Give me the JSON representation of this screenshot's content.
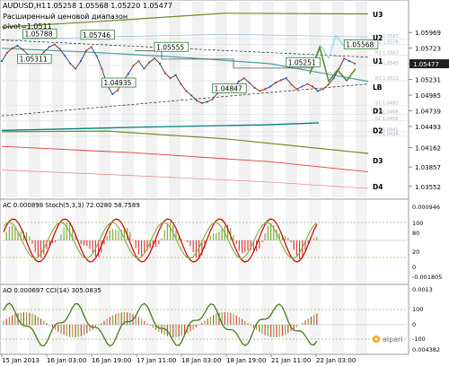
{
  "chart_data": {
    "type": "line",
    "header": {
      "symbol": "AUDUSD,H1",
      "ohlc": "1.05258 1.05568 1.05220 1.05477",
      "subtitle_line1": "Расширенный ценовой диапазон",
      "subtitle_line2": "pivot=1.0511"
    },
    "price_axis": {
      "ylim": [
        1.0338,
        1.0645
      ],
      "ticks": [
        1.05969,
        1.05723,
        1.05477,
        1.05231,
        1.04985,
        1.04739,
        1.04493,
        1.04162,
        1.03857,
        1.03552
      ],
      "current_price": 1.05477
    },
    "level_labels": [
      {
        "label": "U3",
        "value": 1.0625
      },
      {
        "label": "U2",
        "value": 1.0589
      },
      {
        "label": "U1",
        "value": 1.0552
      },
      {
        "label": "LB",
        "value": 1.0511
      },
      {
        "label": "D1",
        "value": 1.0474
      },
      {
        "label": "D2",
        "value": 1.0443
      },
      {
        "label": "D3",
        "value": 1.0396
      },
      {
        "label": "D4",
        "value": 1.0355
      }
    ],
    "fib_labels": [
      {
        "label": "R1 1.0587",
        "value": 1.0587
      },
      {
        "label": "R1 1.0578",
        "value": 1.0578
      },
      {
        "label": "R3 1.0561",
        "value": 1.0561
      },
      {
        "label": "R1 1.0545",
        "value": 1.0545
      },
      {
        "label": "R1 1.0521",
        "value": 1.0521
      },
      {
        "label": "S1 1.0482",
        "value": 1.0482
      },
      {
        "label": "S1 1.0468",
        "value": 1.0468
      },
      {
        "label": "S1 1.0458",
        "value": 1.0458
      },
      {
        "label": "S1 1.0441",
        "value": 1.0441
      },
      {
        "label": "S1 1.0434",
        "value": 1.0434
      }
    ],
    "annotations": [
      {
        "text": "1.05788",
        "x": 4,
        "y": 1.0591
      },
      {
        "text": "1.05746",
        "x": 15,
        "y": 1.0589
      },
      {
        "text": "1.05555",
        "x": 29,
        "y": 1.057
      },
      {
        "text": "1.05311",
        "x": 3,
        "y": 1.0551
      },
      {
        "text": "1.04935",
        "x": 19,
        "y": 1.0514
      },
      {
        "text": "1.05251",
        "x": 54,
        "y": 1.0546
      },
      {
        "text": "1.04847",
        "x": 40,
        "y": 1.0505
      },
      {
        "text": "1.05568",
        "x": 65,
        "y": 1.0574
      }
    ],
    "x_axis_labels": [
      "15 Jan 2013",
      "16 Jan 03:00",
      "16 Jan 19:00",
      "17 Jan 11:00",
      "18 Jan 03:00",
      "18 Jan 19:00",
      "21 Jan 11:00",
      "22 Jan 03:00"
    ],
    "price_series": {
      "x": [
        0,
        1,
        2,
        3,
        4,
        5,
        6,
        7,
        8,
        9,
        10,
        11,
        12,
        13,
        14,
        15,
        16,
        17,
        18,
        19,
        20,
        21,
        22,
        23,
        24,
        25,
        26,
        27,
        28,
        29,
        30,
        31,
        32,
        33,
        34,
        35,
        36,
        37,
        38,
        39,
        40,
        41,
        42,
        43,
        44,
        45,
        46,
        47,
        48,
        49,
        50,
        51,
        52,
        53,
        54,
        55,
        56,
        57,
        58,
        59,
        60,
        61,
        62,
        63,
        64,
        65,
        66,
        67
      ],
      "close": [
        1.0552,
        1.0565,
        1.0572,
        1.0576,
        1.057,
        1.0562,
        1.0555,
        1.0558,
        1.0566,
        1.0574,
        1.0578,
        1.0571,
        1.056,
        1.0548,
        1.054,
        1.0552,
        1.0568,
        1.0574,
        1.056,
        1.054,
        1.0515,
        1.05,
        1.0506,
        1.052,
        1.0532,
        1.0545,
        1.0552,
        1.054,
        1.055,
        1.0556,
        1.0548,
        1.0533,
        1.0525,
        1.053,
        1.0516,
        1.0505,
        1.0498,
        1.049,
        1.0486,
        1.0488,
        1.0492,
        1.0502,
        1.051,
        1.0505,
        1.0512,
        1.052,
        1.0525,
        1.0518,
        1.051,
        1.0505,
        1.0508,
        1.0512,
        1.0518,
        1.0522,
        1.0525,
        1.0515,
        1.0508,
        1.0512,
        1.0516,
        1.0512,
        1.0505,
        1.0508,
        1.0515,
        1.0525,
        1.054,
        1.0556,
        1.0552,
        1.0548
      ]
    },
    "ac_panel": {
      "label": "AC 0.000898  Stoch(5,3,3) 72.0280 58.7589",
      "ticks_right": [
        "100",
        "80",
        "20",
        "0"
      ],
      "ticks_left": [
        "0.000946",
        "-0.001805"
      ]
    },
    "ao_panel": {
      "label": "AO 0.000697 CCI(14) 305.0835",
      "ticks_right": [
        "0.0013",
        "100",
        "0",
        "-100",
        "0.004382"
      ]
    },
    "watermark": "alpari"
  }
}
